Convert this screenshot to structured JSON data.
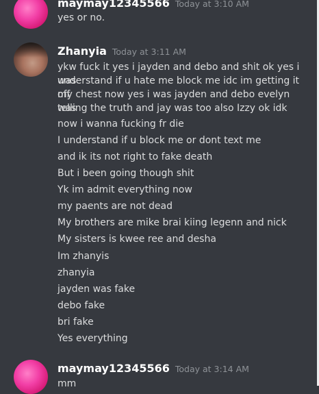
{
  "messages": [
    {
      "username": "maymay12345566",
      "timestamp": "Today at 3:10 AM",
      "avatar": "pink-blob-avatar",
      "lines": [
        "yes or no."
      ]
    },
    {
      "username": "Zhanyia",
      "timestamp": "Today at 3:11 AM",
      "avatar": "face-photo-avatar",
      "lines": [
        "ykw fuck it yes i jayden and debo and shit ok yes i was",
        "understand if u hate me block me idc im getting it off",
        "my chest now yes i was jayden and debo evelyn was",
        "telling the truth and jay was too also Izzy ok idk",
        "now i wanna fucking fr die",
        "I understand if u block me or dont text me",
        "and ik its not right to fake death",
        "But i been going though shit",
        "Yk im admit everything now",
        "my paents are not dead",
        "My brothers are mike brai kiing legenn and nick",
        "My sisters is kwee ree and desha",
        "Im zhanyis",
        "zhanyia",
        "jayden was fake",
        "debo fake",
        "bri fake",
        "Yes everything"
      ]
    },
    {
      "username": "maymay12345566",
      "timestamp": "Today at 3:14 AM",
      "avatar": "pink-blob-avatar",
      "lines": [
        "mm"
      ]
    }
  ]
}
